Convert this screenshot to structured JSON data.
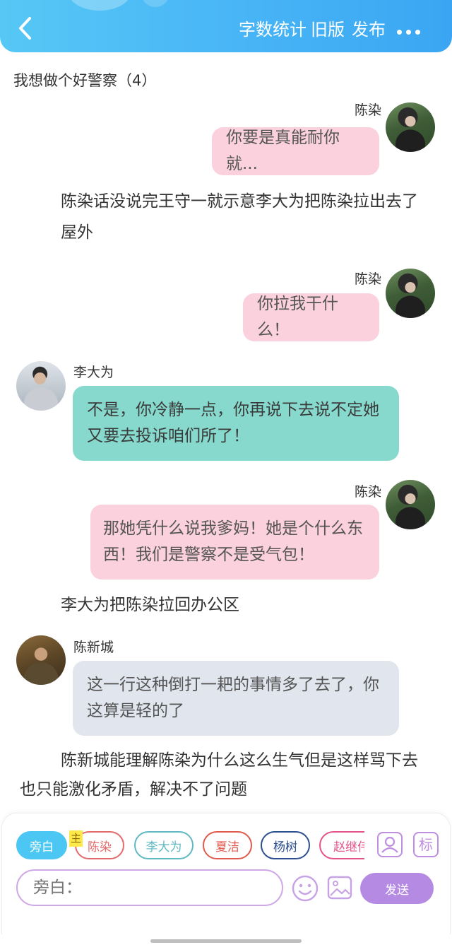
{
  "header": {
    "back_icon": "chevron-left-icon",
    "stats": "字数统计",
    "old_version": "旧版",
    "publish": "发布",
    "more_icon": "more-dots-icon"
  },
  "story": {
    "title": "我想做个好警察（4）"
  },
  "messages": [
    {
      "speaker": "陈染",
      "text": "你要是真能耐你就..."
    },
    {
      "text": "陈染话没说完王守一就示意李大为把陈染拉出去了屋外"
    },
    {
      "speaker": "陈染",
      "text": "你拉我干什么！"
    },
    {
      "speaker": "李大为",
      "text": "不是，你冷静一点，你再说下去说不定她又要去投诉咱们所了！"
    },
    {
      "speaker": "陈染",
      "text": "那她凭什么说我爹妈！她是个什么东西！我们是警察不是受气包！"
    },
    {
      "text": "李大为把陈染拉回办公区"
    },
    {
      "speaker": "陈新城",
      "text": "这一行这种倒打一耙的事情多了去了，你这算是轻的了"
    },
    {
      "text": "陈新城能理解陈染为什么这么生气但是这样骂下去也只能激化矛盾，解决不了问题"
    }
  ],
  "roles": {
    "narrator": "旁白",
    "main_tag": "主",
    "chenran": "陈染",
    "lidawei": "李大为",
    "xiajie": "夏洁",
    "yangshu": "杨树",
    "zhaojiwei": "赵继伟",
    "mark": "标"
  },
  "composer": {
    "placeholder": "旁白：",
    "send": "发送"
  },
  "colors": {
    "header": "#49b6f6",
    "pink_bubble": "#fad1dc",
    "teal_bubble": "#86d9cc",
    "grey_bubble": "#e1e6ee",
    "send": "#b58ae3"
  }
}
